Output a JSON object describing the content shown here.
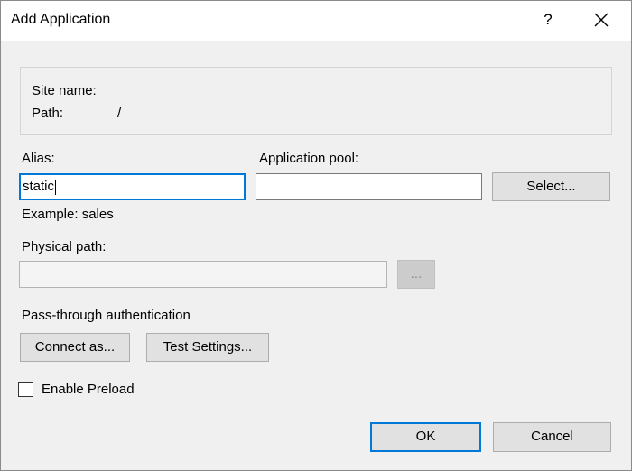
{
  "window": {
    "title": "Add Application",
    "help_glyph": "?",
    "icons": {
      "close": "close-icon",
      "help": "help-icon"
    }
  },
  "info": {
    "site_name_label": "Site name:",
    "site_name_value": "",
    "path_label": "Path:",
    "path_value": "/"
  },
  "alias": {
    "label": "Alias:",
    "value": "static",
    "example": "Example: sales"
  },
  "app_pool": {
    "label": "Application pool:",
    "value": "",
    "select_button": "Select..."
  },
  "physical_path": {
    "label": "Physical path:",
    "value": "",
    "browse_button": "..."
  },
  "auth": {
    "label": "Pass-through authentication",
    "connect_button": "Connect as...",
    "test_button": "Test Settings..."
  },
  "preload": {
    "label": "Enable Preload",
    "checked": false
  },
  "footer": {
    "ok_label": "OK",
    "cancel_label": "Cancel"
  },
  "colors": {
    "accent": "#0078d7",
    "dialog_bg": "#f0f0f0",
    "button_bg": "#e1e1e1"
  }
}
